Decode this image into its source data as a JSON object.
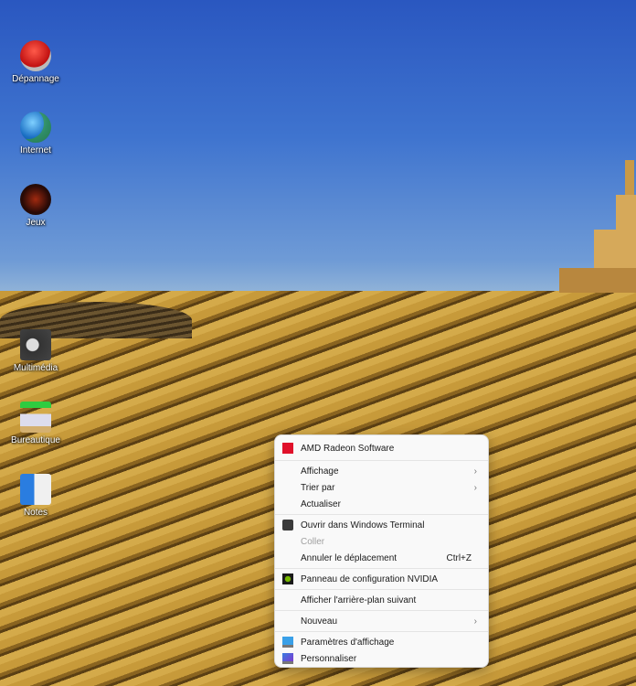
{
  "desktop_icons": [
    {
      "label": "Dépannage",
      "icon": "help-button-icon"
    },
    {
      "label": "Internet",
      "icon": "globe-icon"
    },
    {
      "label": "Jeux",
      "icon": "games-icon"
    },
    {
      "label": "Multimédia",
      "icon": "film-reel-folder-icon"
    },
    {
      "label": "Bureautique",
      "icon": "office-lamp-icon"
    },
    {
      "label": "Notes",
      "icon": "notes-icon"
    }
  ],
  "context_menu": {
    "amd": "AMD Radeon Software",
    "affichage": "Affichage",
    "trier": "Trier par",
    "actualiser": "Actualiser",
    "terminal": "Ouvrir dans Windows Terminal",
    "coller": "Coller",
    "annuler": "Annuler le déplacement",
    "annuler_shortcut": "Ctrl+Z",
    "nvidia": "Panneau de configuration NVIDIA",
    "arriere_plan": "Afficher l'arrière-plan suivant",
    "nouveau": "Nouveau",
    "parametres": "Paramètres d'affichage",
    "personnaliser": "Personnaliser",
    "submenu_arrow": "›"
  }
}
